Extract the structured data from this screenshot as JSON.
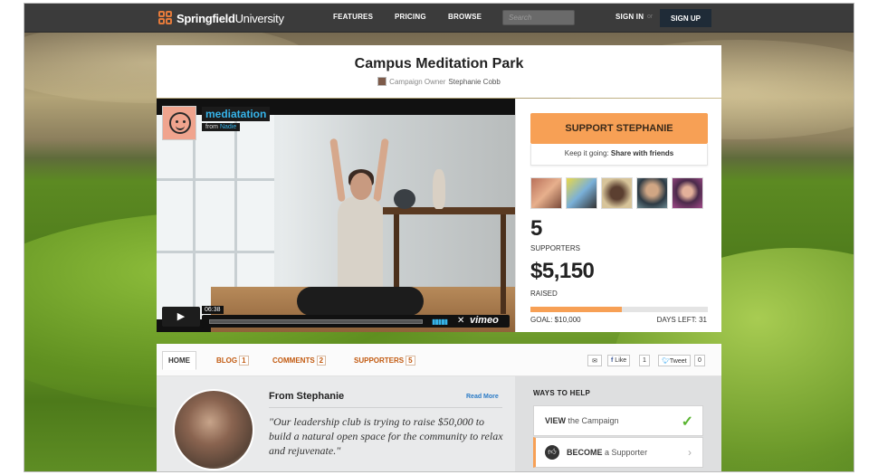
{
  "topbar": {
    "logo_text_1": "Springfield",
    "logo_text_2": "University",
    "nav": [
      "FEATURES",
      "PRICING",
      "BROWSE"
    ],
    "search_placeholder": "Search",
    "sign_in": "SIGN IN",
    "or": "or",
    "sign_up": "SIGN UP"
  },
  "campaign": {
    "title": "Campus Meditation Park",
    "owner_label": "Campaign Owner",
    "owner_name": "Stephanie Cobb"
  },
  "video": {
    "title": "mediatation",
    "from_label": "from",
    "from_user": "Nadie",
    "time": "06:38",
    "brand": "vimeo"
  },
  "sidebar": {
    "support_button": "SUPPORT STEPHANIE",
    "keep_going": "Keep it going:",
    "share_label": "Share with friends",
    "supporters_count": "5",
    "supporters_label": "SUPPORTERS",
    "raised_amount": "$5,150",
    "raised_label": "RAISED",
    "progress_fraction": 0.515,
    "goal": "GOAL: $10,000",
    "days_left": "DAYS LEFT: 31"
  },
  "tabs": [
    {
      "label": "HOME",
      "count": ""
    },
    {
      "label": "BLOG",
      "count": "1"
    },
    {
      "label": "COMMENTS",
      "count": "2"
    },
    {
      "label": "SUPPORTERS",
      "count": "5"
    }
  ],
  "social": {
    "like": "Like",
    "like_count": "1",
    "tweet": "Tweet",
    "tweet_count": "0"
  },
  "post": {
    "heading": "From Stephanie",
    "read_more": "Read More",
    "quote": "\"Our leadership club is trying to raise $50,000 to build a natural open space for the community to relax and rejuvenate.\""
  },
  "ways": {
    "heading": "WAYS TO HELP",
    "view_bold": "VIEW",
    "view_rest": "the Campaign",
    "become_bold": "BECOME",
    "become_rest": "a Supporter"
  },
  "colors": {
    "accent": "#f7a055",
    "link": "#2b7bc6",
    "tab": "#c25a10",
    "topbar": "#3b3b3b"
  }
}
